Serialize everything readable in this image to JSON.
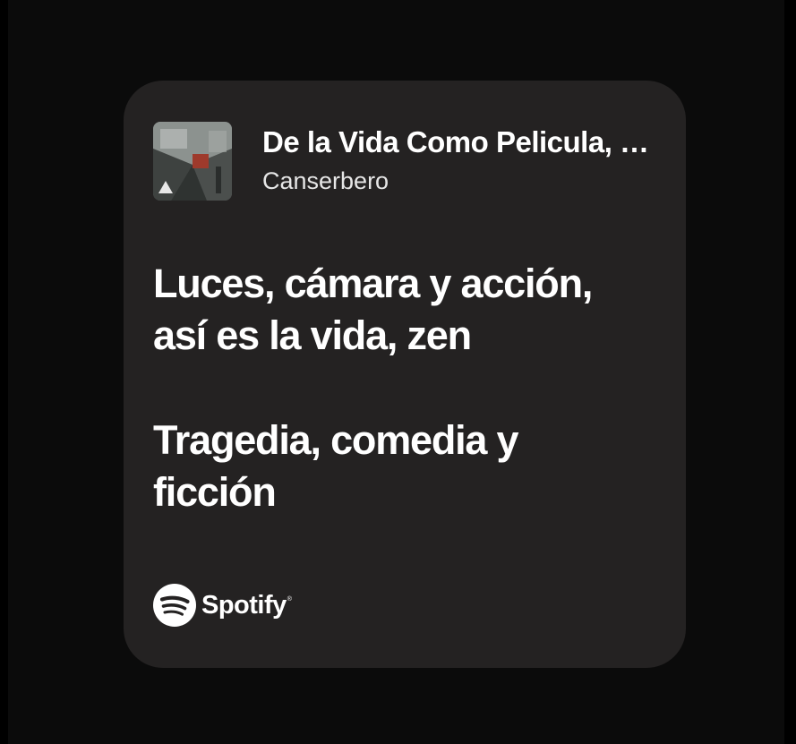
{
  "track": {
    "title": "De la Vida Como Pelicula, …",
    "artist": "Canserbero"
  },
  "lyrics": [
    {
      "lines": [
        "Luces, cámara y acción,",
        "así es la vida, zen"
      ]
    },
    {
      "lines": [
        "Tragedia, comedia y",
        "ficción"
      ]
    }
  ],
  "brand": {
    "icon": "spotify-icon",
    "name": "Spotify",
    "reg": "®"
  },
  "colors": {
    "background": "#0b0b0b",
    "card": "#242222",
    "text": "#ffffff"
  }
}
